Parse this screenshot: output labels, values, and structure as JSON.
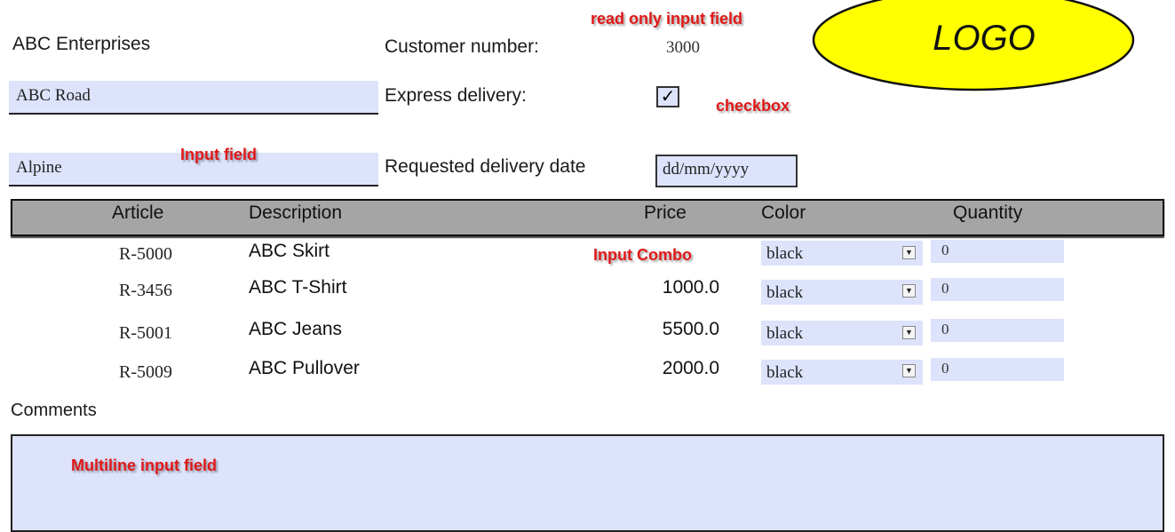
{
  "company": {
    "name": "ABC Enterprises",
    "street": "ABC Road",
    "city": "Alpine"
  },
  "customer": {
    "label": "Customer number:",
    "value": "3000"
  },
  "express": {
    "label": "Express delivery:",
    "checked_glyph": "✓"
  },
  "delivery_date": {
    "label": "Requested delivery date",
    "placeholder": "dd/mm/yyyy"
  },
  "logo": {
    "text": "LOGO"
  },
  "annotations": {
    "read_only": "read only input field",
    "checkbox": "checkbox",
    "input_field": "Input field",
    "input_combo": "Input Combo",
    "multiline": "Multiline input field"
  },
  "table": {
    "headers": [
      "Article",
      "Description",
      "Price",
      "Color",
      "Quantity"
    ],
    "rows": [
      {
        "article": "R-5000",
        "description": "ABC Skirt",
        "price": "",
        "color": "black",
        "quantity": "0"
      },
      {
        "article": "R-3456",
        "description": "ABC T-Shirt",
        "price": "1000.0",
        "color": "black",
        "quantity": "0"
      },
      {
        "article": "R-5001",
        "description": "ABC Jeans",
        "price": "5500.0",
        "color": "black",
        "quantity": "0"
      },
      {
        "article": "R-5009",
        "description": "ABC Pullover",
        "price": "2000.0",
        "color": "black",
        "quantity": "0"
      }
    ]
  },
  "comments": {
    "label": "Comments"
  },
  "colors": {
    "field_bg": "#dde3fb",
    "header_bg": "#a5a5a5",
    "logo_fill": "#ffff00",
    "annotation": "#e01818"
  }
}
